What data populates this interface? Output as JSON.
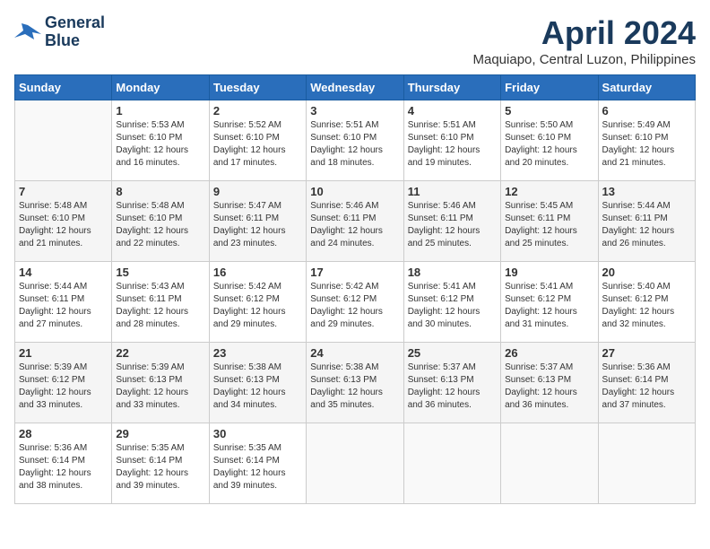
{
  "logo": {
    "line1": "General",
    "line2": "Blue"
  },
  "title": "April 2024",
  "subtitle": "Maquiapo, Central Luzon, Philippines",
  "days_of_week": [
    "Sunday",
    "Monday",
    "Tuesday",
    "Wednesday",
    "Thursday",
    "Friday",
    "Saturday"
  ],
  "weeks": [
    [
      {
        "day": "",
        "sunrise": "",
        "sunset": "",
        "daylight": ""
      },
      {
        "day": "1",
        "sunrise": "Sunrise: 5:53 AM",
        "sunset": "Sunset: 6:10 PM",
        "daylight": "Daylight: 12 hours and 16 minutes."
      },
      {
        "day": "2",
        "sunrise": "Sunrise: 5:52 AM",
        "sunset": "Sunset: 6:10 PM",
        "daylight": "Daylight: 12 hours and 17 minutes."
      },
      {
        "day": "3",
        "sunrise": "Sunrise: 5:51 AM",
        "sunset": "Sunset: 6:10 PM",
        "daylight": "Daylight: 12 hours and 18 minutes."
      },
      {
        "day": "4",
        "sunrise": "Sunrise: 5:51 AM",
        "sunset": "Sunset: 6:10 PM",
        "daylight": "Daylight: 12 hours and 19 minutes."
      },
      {
        "day": "5",
        "sunrise": "Sunrise: 5:50 AM",
        "sunset": "Sunset: 6:10 PM",
        "daylight": "Daylight: 12 hours and 20 minutes."
      },
      {
        "day": "6",
        "sunrise": "Sunrise: 5:49 AM",
        "sunset": "Sunset: 6:10 PM",
        "daylight": "Daylight: 12 hours and 21 minutes."
      }
    ],
    [
      {
        "day": "7",
        "sunrise": "Sunrise: 5:48 AM",
        "sunset": "Sunset: 6:10 PM",
        "daylight": "Daylight: 12 hours and 21 minutes."
      },
      {
        "day": "8",
        "sunrise": "Sunrise: 5:48 AM",
        "sunset": "Sunset: 6:10 PM",
        "daylight": "Daylight: 12 hours and 22 minutes."
      },
      {
        "day": "9",
        "sunrise": "Sunrise: 5:47 AM",
        "sunset": "Sunset: 6:11 PM",
        "daylight": "Daylight: 12 hours and 23 minutes."
      },
      {
        "day": "10",
        "sunrise": "Sunrise: 5:46 AM",
        "sunset": "Sunset: 6:11 PM",
        "daylight": "Daylight: 12 hours and 24 minutes."
      },
      {
        "day": "11",
        "sunrise": "Sunrise: 5:46 AM",
        "sunset": "Sunset: 6:11 PM",
        "daylight": "Daylight: 12 hours and 25 minutes."
      },
      {
        "day": "12",
        "sunrise": "Sunrise: 5:45 AM",
        "sunset": "Sunset: 6:11 PM",
        "daylight": "Daylight: 12 hours and 25 minutes."
      },
      {
        "day": "13",
        "sunrise": "Sunrise: 5:44 AM",
        "sunset": "Sunset: 6:11 PM",
        "daylight": "Daylight: 12 hours and 26 minutes."
      }
    ],
    [
      {
        "day": "14",
        "sunrise": "Sunrise: 5:44 AM",
        "sunset": "Sunset: 6:11 PM",
        "daylight": "Daylight: 12 hours and 27 minutes."
      },
      {
        "day": "15",
        "sunrise": "Sunrise: 5:43 AM",
        "sunset": "Sunset: 6:11 PM",
        "daylight": "Daylight: 12 hours and 28 minutes."
      },
      {
        "day": "16",
        "sunrise": "Sunrise: 5:42 AM",
        "sunset": "Sunset: 6:12 PM",
        "daylight": "Daylight: 12 hours and 29 minutes."
      },
      {
        "day": "17",
        "sunrise": "Sunrise: 5:42 AM",
        "sunset": "Sunset: 6:12 PM",
        "daylight": "Daylight: 12 hours and 29 minutes."
      },
      {
        "day": "18",
        "sunrise": "Sunrise: 5:41 AM",
        "sunset": "Sunset: 6:12 PM",
        "daylight": "Daylight: 12 hours and 30 minutes."
      },
      {
        "day": "19",
        "sunrise": "Sunrise: 5:41 AM",
        "sunset": "Sunset: 6:12 PM",
        "daylight": "Daylight: 12 hours and 31 minutes."
      },
      {
        "day": "20",
        "sunrise": "Sunrise: 5:40 AM",
        "sunset": "Sunset: 6:12 PM",
        "daylight": "Daylight: 12 hours and 32 minutes."
      }
    ],
    [
      {
        "day": "21",
        "sunrise": "Sunrise: 5:39 AM",
        "sunset": "Sunset: 6:12 PM",
        "daylight": "Daylight: 12 hours and 33 minutes."
      },
      {
        "day": "22",
        "sunrise": "Sunrise: 5:39 AM",
        "sunset": "Sunset: 6:13 PM",
        "daylight": "Daylight: 12 hours and 33 minutes."
      },
      {
        "day": "23",
        "sunrise": "Sunrise: 5:38 AM",
        "sunset": "Sunset: 6:13 PM",
        "daylight": "Daylight: 12 hours and 34 minutes."
      },
      {
        "day": "24",
        "sunrise": "Sunrise: 5:38 AM",
        "sunset": "Sunset: 6:13 PM",
        "daylight": "Daylight: 12 hours and 35 minutes."
      },
      {
        "day": "25",
        "sunrise": "Sunrise: 5:37 AM",
        "sunset": "Sunset: 6:13 PM",
        "daylight": "Daylight: 12 hours and 36 minutes."
      },
      {
        "day": "26",
        "sunrise": "Sunrise: 5:37 AM",
        "sunset": "Sunset: 6:13 PM",
        "daylight": "Daylight: 12 hours and 36 minutes."
      },
      {
        "day": "27",
        "sunrise": "Sunrise: 5:36 AM",
        "sunset": "Sunset: 6:14 PM",
        "daylight": "Daylight: 12 hours and 37 minutes."
      }
    ],
    [
      {
        "day": "28",
        "sunrise": "Sunrise: 5:36 AM",
        "sunset": "Sunset: 6:14 PM",
        "daylight": "Daylight: 12 hours and 38 minutes."
      },
      {
        "day": "29",
        "sunrise": "Sunrise: 5:35 AM",
        "sunset": "Sunset: 6:14 PM",
        "daylight": "Daylight: 12 hours and 39 minutes."
      },
      {
        "day": "30",
        "sunrise": "Sunrise: 5:35 AM",
        "sunset": "Sunset: 6:14 PM",
        "daylight": "Daylight: 12 hours and 39 minutes."
      },
      {
        "day": "",
        "sunrise": "",
        "sunset": "",
        "daylight": ""
      },
      {
        "day": "",
        "sunrise": "",
        "sunset": "",
        "daylight": ""
      },
      {
        "day": "",
        "sunrise": "",
        "sunset": "",
        "daylight": ""
      },
      {
        "day": "",
        "sunrise": "",
        "sunset": "",
        "daylight": ""
      }
    ]
  ]
}
